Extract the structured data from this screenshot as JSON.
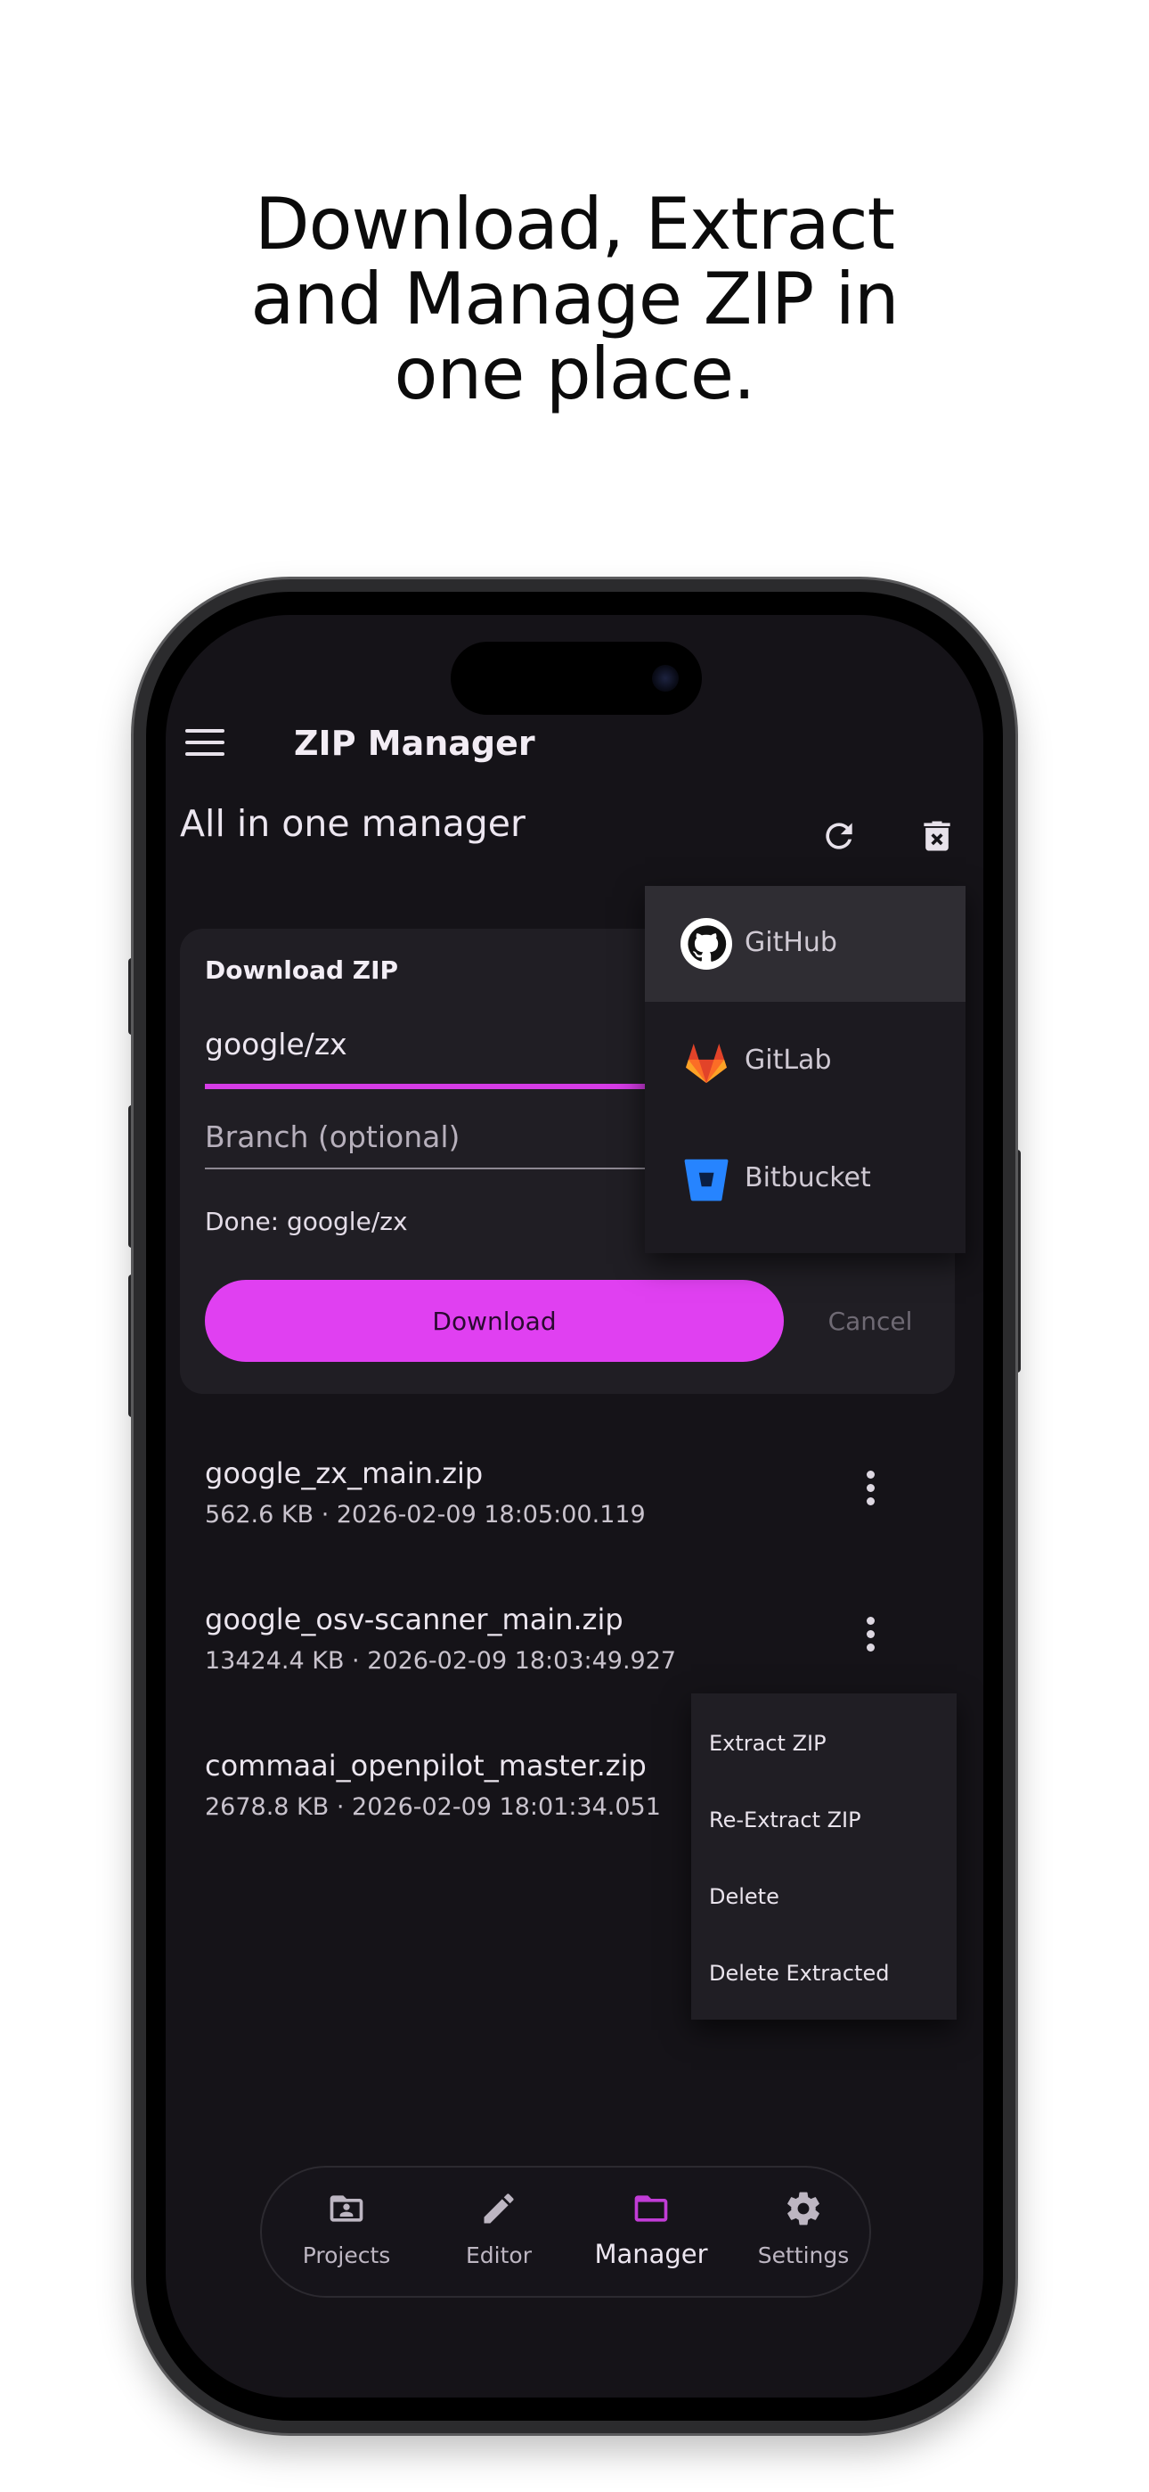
{
  "headline": {
    "line1": "Download, Extract",
    "line2": "and Manage ZIP in",
    "line3": "one place."
  },
  "app": {
    "title": "ZIP Manager",
    "section_title": "All in one manager",
    "menu_icon": "hamburger-menu-icon",
    "actions": [
      "refresh-icon",
      "delete-all-icon"
    ]
  },
  "download_card": {
    "title": "Download ZIP",
    "repo_value": "google/zx",
    "branch_placeholder": "Branch (optional)",
    "status": "Done: google/zx",
    "download_label": "Download",
    "cancel_label": "Cancel",
    "accent_color": "#e040f1"
  },
  "provider_menu": {
    "items": [
      {
        "label": "GitHub",
        "icon": "github-icon",
        "selected": true
      },
      {
        "label": "GitLab",
        "icon": "gitlab-icon",
        "selected": false
      },
      {
        "label": "Bitbucket",
        "icon": "bitbucket-icon",
        "selected": false
      }
    ]
  },
  "files": [
    {
      "name": "google_zx_main.zip",
      "meta": "562.6 KB · 2026-02-09 18:05:00.119"
    },
    {
      "name": "google_osv-scanner_main.zip",
      "meta": "13424.4 KB · 2026-02-09 18:03:49.927"
    },
    {
      "name": "commaai_openpilot_master.zip",
      "meta": "2678.8 KB · 2026-02-09 18:01:34.051"
    }
  ],
  "context_menu": {
    "items": [
      "Extract ZIP",
      "Re-Extract ZIP",
      "Delete",
      "Delete Extracted"
    ]
  },
  "bottom_nav": {
    "items": [
      {
        "label": "Projects",
        "icon": "projects-folder-icon"
      },
      {
        "label": "Editor",
        "icon": "pencil-icon"
      },
      {
        "label": "Manager",
        "icon": "folder-icon",
        "active": true
      },
      {
        "label": "Settings",
        "icon": "gear-icon"
      }
    ]
  }
}
